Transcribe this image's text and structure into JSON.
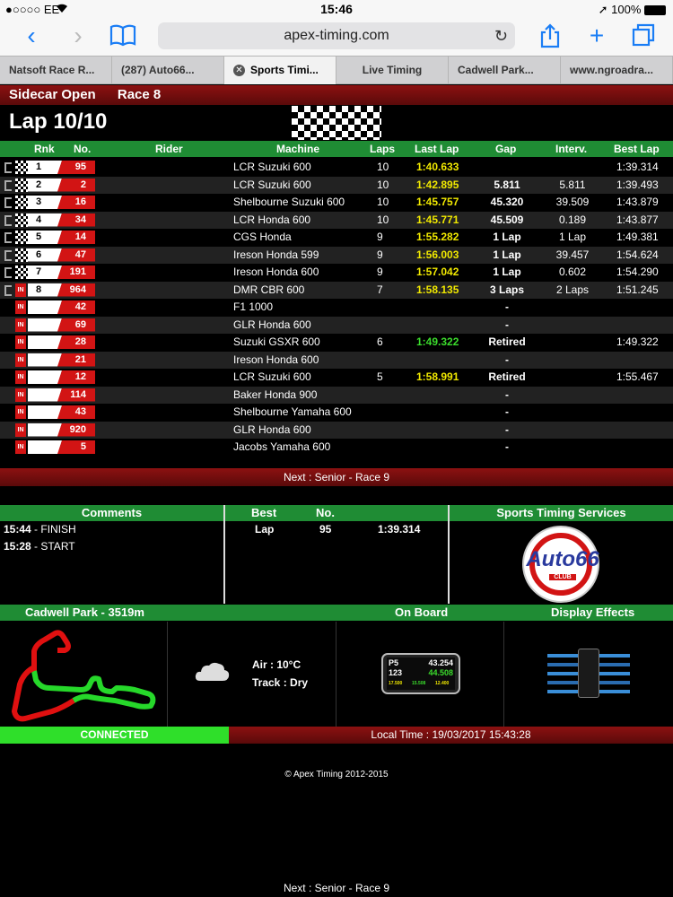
{
  "status_bar": {
    "carrier": "●○○○○ EE",
    "time": "15:46",
    "battery": "100%"
  },
  "browser": {
    "url": "apex-timing.com"
  },
  "tabs": [
    {
      "label": "Natsoft Race R...",
      "active": false
    },
    {
      "label": "(287) Auto66...",
      "active": false
    },
    {
      "label": "Sports Timi...",
      "active": true
    },
    {
      "label": "Live Timing",
      "active": false
    },
    {
      "label": "Cadwell Park...",
      "active": false
    },
    {
      "label": "www.ngroadra...",
      "active": false
    }
  ],
  "race": {
    "class": "Sidecar Open",
    "name": "Race 8",
    "lap": "Lap 10/10"
  },
  "table_headers": {
    "rnk": "Rnk",
    "no": "No.",
    "rider": "Rider",
    "machine": "Machine",
    "laps": "Laps",
    "last_lap": "Last Lap",
    "gap": "Gap",
    "interv": "Interv.",
    "best_lap": "Best Lap"
  },
  "rows": [
    {
      "rank": "1",
      "no": "95",
      "machine": "LCR Suzuki 600",
      "laps": "10",
      "last": "1:40.633",
      "gap": "",
      "interv": "",
      "best": "1:39.314",
      "status": "finished"
    },
    {
      "rank": "2",
      "no": "2",
      "machine": "LCR Suzuki 600",
      "laps": "10",
      "last": "1:42.895",
      "gap": "5.811",
      "interv": "5.811",
      "best": "1:39.493",
      "status": "finished"
    },
    {
      "rank": "3",
      "no": "16",
      "machine": "Shelbourne Suzuki 600",
      "laps": "10",
      "last": "1:45.757",
      "gap": "45.320",
      "interv": "39.509",
      "best": "1:43.879",
      "status": "finished"
    },
    {
      "rank": "4",
      "no": "34",
      "machine": "LCR Honda 600",
      "laps": "10",
      "last": "1:45.771",
      "gap": "45.509",
      "interv": "0.189",
      "best": "1:43.877",
      "status": "finished"
    },
    {
      "rank": "5",
      "no": "14",
      "machine": "CGS Honda",
      "laps": "9",
      "last": "1:55.282",
      "gap": "1 Lap",
      "interv": "1 Lap",
      "best": "1:49.381",
      "status": "finished"
    },
    {
      "rank": "6",
      "no": "47",
      "machine": "Ireson Honda 599",
      "laps": "9",
      "last": "1:56.003",
      "gap": "1 Lap",
      "interv": "39.457",
      "best": "1:54.624",
      "status": "finished"
    },
    {
      "rank": "7",
      "no": "191",
      "machine": "Ireson Honda 600",
      "laps": "9",
      "last": "1:57.042",
      "gap": "1 Lap",
      "interv": "0.602",
      "best": "1:54.290",
      "status": "finished"
    },
    {
      "rank": "8",
      "no": "964",
      "machine": "DMR CBR 600",
      "laps": "7",
      "last": "1:58.135",
      "gap": "3 Laps",
      "interv": "2 Laps",
      "best": "1:51.245",
      "status": "finished-in"
    },
    {
      "rank": "",
      "no": "42",
      "machine": "F1 1000",
      "laps": "",
      "last": "",
      "gap": "-",
      "interv": "",
      "best": "",
      "status": "in"
    },
    {
      "rank": "",
      "no": "69",
      "machine": "GLR Honda 600",
      "laps": "",
      "last": "",
      "gap": "-",
      "interv": "",
      "best": "",
      "status": "in"
    },
    {
      "rank": "",
      "no": "28",
      "machine": "Suzuki GSXR 600",
      "laps": "6",
      "last": "1:49.322",
      "gap": "Retired",
      "interv": "",
      "best": "1:49.322",
      "status": "in",
      "last_color": "green"
    },
    {
      "rank": "",
      "no": "21",
      "machine": "Ireson Honda 600",
      "laps": "",
      "last": "",
      "gap": "-",
      "interv": "",
      "best": "",
      "status": "in"
    },
    {
      "rank": "",
      "no": "12",
      "machine": "LCR Suzuki 600",
      "laps": "5",
      "last": "1:58.991",
      "gap": "Retired",
      "interv": "",
      "best": "1:55.467",
      "status": "in"
    },
    {
      "rank": "",
      "no": "114",
      "machine": "Baker Honda 900",
      "laps": "",
      "last": "",
      "gap": "-",
      "interv": "",
      "best": "",
      "status": "in"
    },
    {
      "rank": "",
      "no": "43",
      "machine": "Shelbourne Yamaha 600",
      "laps": "",
      "last": "",
      "gap": "-",
      "interv": "",
      "best": "",
      "status": "in"
    },
    {
      "rank": "",
      "no": "920",
      "machine": "GLR Honda 600",
      "laps": "",
      "last": "",
      "gap": "-",
      "interv": "",
      "best": "",
      "status": "in"
    },
    {
      "rank": "",
      "no": "5",
      "machine": "Jacobs Yamaha 600",
      "laps": "",
      "last": "",
      "gap": "-",
      "interv": "",
      "best": "",
      "status": "in"
    }
  ],
  "in_badge": "IN",
  "next_race": "Next : Senior - Race 9",
  "comments": {
    "title": "Comments",
    "items": [
      {
        "time": "15:44",
        "text": " - FINISH"
      },
      {
        "time": "15:28",
        "text": " - START"
      }
    ]
  },
  "best": {
    "title": "Best",
    "no_header": "No.",
    "row_label": "Lap",
    "row_no": "95",
    "row_time": "1:39.314"
  },
  "sponsor": {
    "title": "Sports Timing Services",
    "logo_text": "Auto66",
    "logo_sub": "CLUB"
  },
  "track": {
    "title": "Cadwell Park - 3519m"
  },
  "onboard": {
    "title": "On Board",
    "p": "P5",
    "speed": "43.254",
    "lap": "123",
    "delta": "44.508",
    "small1": "17.500",
    "small2": "15.508",
    "small3": "12.400"
  },
  "display_effects": {
    "title": "Display Effects"
  },
  "weather": {
    "air": "Air : 10°C",
    "track": "Track : Dry"
  },
  "connection": {
    "status": "CONNECTED",
    "local_time": "Local Time : 19/03/2017 15:43:28"
  },
  "footer": {
    "copyright": "© Apex Timing 2012-2015",
    "next": "Next : Senior - Race 9"
  },
  "colors": {
    "accent_red": "#d21414",
    "header_green": "#1f8c34",
    "connected_green": "#2fdf2a",
    "lap_yellow": "#f0e800",
    "ios_blue": "#1a7df5"
  }
}
